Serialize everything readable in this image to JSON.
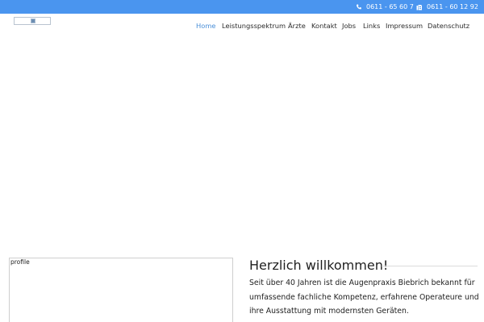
{
  "topbar": {
    "phone_icon": "phone-icon",
    "phone": "0611 - 65 60 7",
    "fax_icon": "fax-icon",
    "fax": "0611 - 60 12 92",
    "background": "#4a95ef"
  },
  "logo": {
    "icon": "logo-image"
  },
  "nav": {
    "items": [
      {
        "label": "Home",
        "active": true
      },
      {
        "label": "Leistungsspektrum"
      },
      {
        "label": "Ärzte"
      },
      {
        "label": "Kontakt"
      },
      {
        "label": "Jobs"
      },
      {
        "label": "Links"
      },
      {
        "label": "Impressum"
      },
      {
        "label": "Datenschutz"
      }
    ],
    "active_color": "#4a8fd8"
  },
  "profile": {
    "alt_text": "profile"
  },
  "welcome": {
    "title": "Herzlich willkommen!",
    "text": "Seit über 40 Jahren ist die Augenpraxis Biebrich bekannt für umfassende fachliche Kompetenz, erfahrene Operateure und ihre Ausstattung mit modernsten Geräten."
  }
}
